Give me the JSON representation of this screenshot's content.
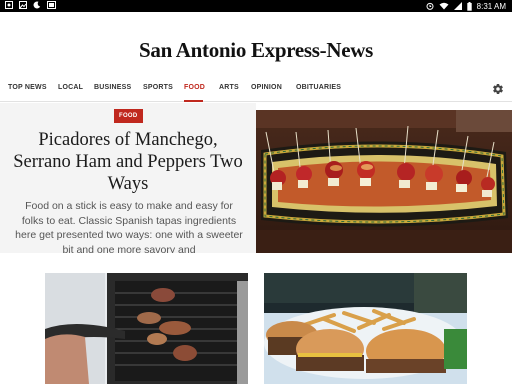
{
  "status_bar": {
    "time": "8:31 AM",
    "left_icons": [
      "photo-icon",
      "gallery-icon",
      "moon-icon",
      "cast-icon"
    ],
    "right_icons": [
      "alarm-icon",
      "wifi-icon",
      "signal-icon",
      "battery-icon"
    ]
  },
  "masthead": {
    "logo_text": "San Antonio Express-News"
  },
  "nav": {
    "items": [
      {
        "label": "TOP NEWS"
      },
      {
        "label": "LOCAL"
      },
      {
        "label": "BUSINESS"
      },
      {
        "label": "SPORTS"
      },
      {
        "label": "FOOD"
      },
      {
        "label": "ARTS"
      },
      {
        "label": "OPINION"
      },
      {
        "label": "OBITUARIES"
      }
    ],
    "active": "FOOD",
    "accent_color": "#c0281e"
  },
  "hero": {
    "tag": "FOOD",
    "headline": "Picadores of Manchego, Serrano Ham and Peppers Two Ways",
    "summary": "Food on a stick is easy to make and easy for folks to eat. Classic Spanish tapas ingredients here get presented two ways: one with a sweeter bit and one more savory and"
  }
}
